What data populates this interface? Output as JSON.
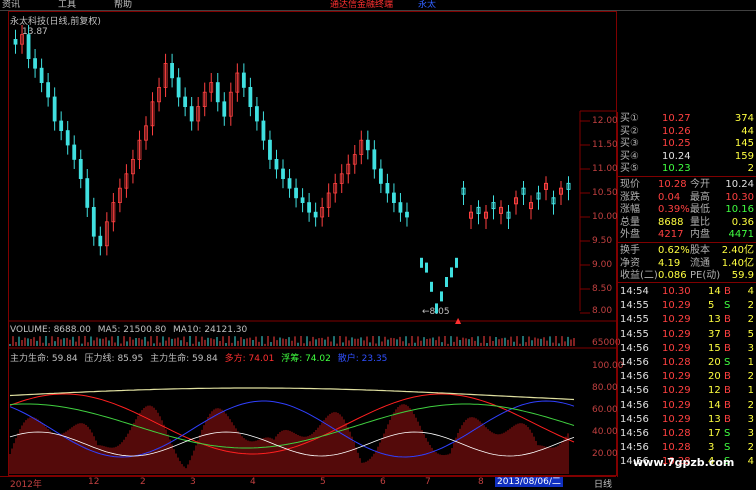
{
  "menu": {
    "items": [
      "资讯",
      "工具",
      "帮助"
    ]
  },
  "news": {
    "text": "通达信金融终端",
    "text2": "永太"
  },
  "chart": {
    "title": "永太科技(日线,前复权)",
    "high_label": "13.87",
    "low_label": "8.05",
    "price_ticks": [
      "12.00",
      "11.50",
      "11.00",
      "10.50",
      "10.00",
      "9.50",
      "9.00",
      "8.50",
      "8.00"
    ],
    "volume_header": {
      "vol": "VOLUME: 8688.00",
      "ma5": "MA5: 21500.80",
      "ma10": "MA10: 24121.30"
    },
    "volume_tick": "65000",
    "indicator_header": {
      "a": "主力生命: 59.84",
      "b": "压力线: 85.95",
      "c": "主力生命: 59.84",
      "d": "多方: 74.01",
      "e": "浮筹: 74.02",
      "f": "散户: 23.35"
    },
    "indicator_ticks": [
      "100.00",
      "80.00",
      "60.00",
      "40.00",
      "20.00"
    ],
    "date_ticks": [
      "2012年",
      "12",
      "2",
      "3",
      "4",
      "5",
      "6",
      "7",
      "8"
    ],
    "cursor_date": "2013/08/06/二",
    "period": "日线"
  },
  "quote": {
    "bids": [
      {
        "label": "买①",
        "price": "10.27",
        "vol": "374"
      },
      {
        "label": "买②",
        "price": "10.26",
        "vol": "44"
      },
      {
        "label": "买③",
        "price": "10.25",
        "vol": "145"
      },
      {
        "label": "买④",
        "price": "10.24",
        "vol": "159"
      },
      {
        "label": "买⑤",
        "price": "10.23",
        "vol": "2"
      }
    ],
    "stats": [
      {
        "l1": "现价",
        "v1": "10.28",
        "l2": "今开",
        "v2": "10.24"
      },
      {
        "l1": "涨跌",
        "v1": "0.04",
        "l2": "最高",
        "v2": "10.30"
      },
      {
        "l1": "涨幅",
        "v1": "0.39%",
        "l2": "最低",
        "v2": "10.16"
      },
      {
        "l1": "总量",
        "v1": "8688",
        "l2": "量比",
        "v2": "0.36"
      },
      {
        "l1": "外盘",
        "v1": "4217",
        "l2": "内盘",
        "v2": "4471"
      }
    ],
    "stats2": [
      {
        "l1": "换手",
        "v1": "0.62%",
        "l2": "股本",
        "v2": "2.40亿"
      },
      {
        "l1": "净资",
        "v1": "4.19",
        "l2": "流通",
        "v2": "1.40亿"
      },
      {
        "l1": "收益(二)",
        "v1": "0.086",
        "l2": "PE(动)",
        "v2": "59.9"
      }
    ],
    "ticks": [
      {
        "t": "14:54",
        "p": "10.30",
        "v": "14",
        "s": "B",
        "n": "4"
      },
      {
        "t": "14:55",
        "p": "10.29",
        "v": "5",
        "s": "S",
        "n": "2"
      },
      {
        "t": "14:55",
        "p": "10.29",
        "v": "13",
        "s": "B",
        "n": "2"
      },
      {
        "t": "14:55",
        "p": "10.29",
        "v": "37",
        "s": "B",
        "n": "5"
      },
      {
        "t": "14:56",
        "p": "10.29",
        "v": "15",
        "s": "B",
        "n": "3"
      },
      {
        "t": "14:56",
        "p": "10.28",
        "v": "20",
        "s": "S",
        "n": "1"
      },
      {
        "t": "14:56",
        "p": "10.29",
        "v": "20",
        "s": "B",
        "n": "2"
      },
      {
        "t": "14:56",
        "p": "10.29",
        "v": "12",
        "s": "B",
        "n": "1"
      },
      {
        "t": "14:56",
        "p": "10.29",
        "v": "14",
        "s": "B",
        "n": "2"
      },
      {
        "t": "14:56",
        "p": "10.29",
        "v": "13",
        "s": "B",
        "n": "3"
      },
      {
        "t": "14:56",
        "p": "10.28",
        "v": "17",
        "s": "S",
        "n": "3"
      },
      {
        "t": "14:56",
        "p": "10.28",
        "v": "3",
        "s": "S",
        "n": "2"
      },
      {
        "t": "14:56",
        "p": "10.28",
        "v": "4",
        "s": "S",
        "n": "4"
      }
    ]
  },
  "watermark": "www.7gpzb.com",
  "colors": {
    "up": "#ff4040",
    "down": "#40e0e0",
    "axis": "#800000"
  }
}
